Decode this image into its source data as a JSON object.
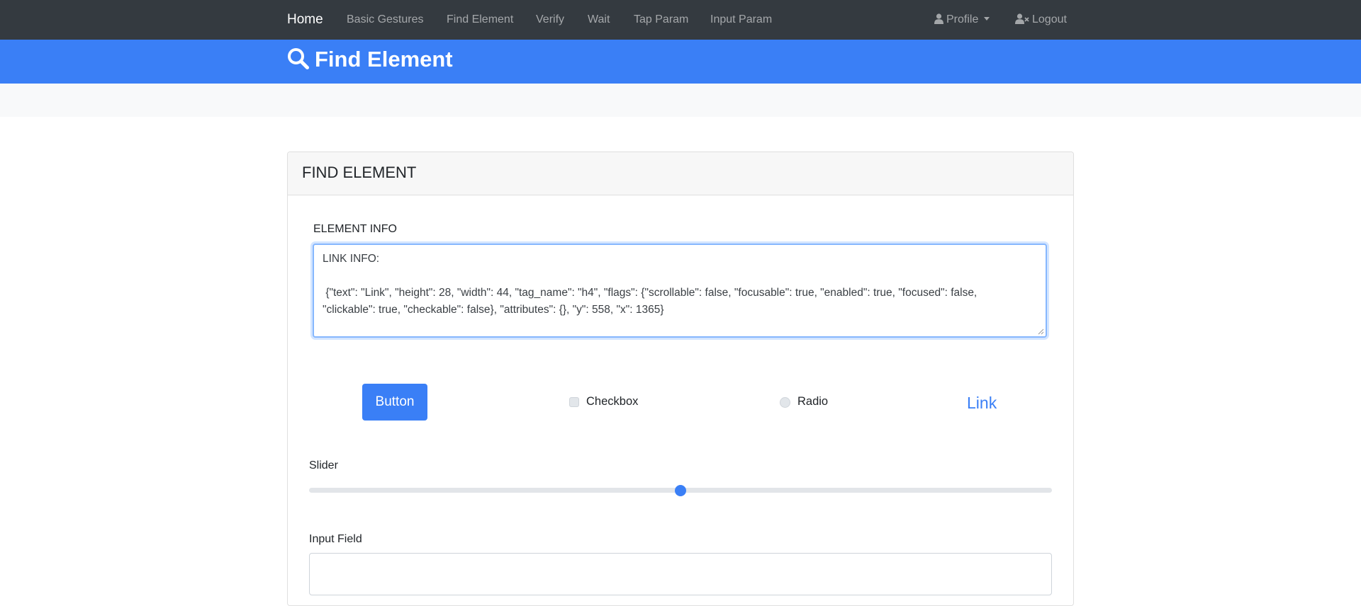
{
  "navbar": {
    "brand": "Home",
    "links": [
      "Basic Gestures",
      "Find Element",
      "Verify",
      "Wait",
      "Tap Param",
      "Input Param"
    ],
    "profile": "Profile",
    "logout": "Logout"
  },
  "hero": {
    "title": "Find Element"
  },
  "card": {
    "title": "FIND ELEMENT",
    "element_info_label": "ELEMENT INFO",
    "element_info_lines": [
      "LINK INFO:",
      "",
      " {\"text\": \"Link\", \"height\": 28, \"width\": 44, \"tag_name\": \"h4\", \"flags\": {\"scrollable\": false, \"focusable\": true, \"enabled\": true, \"focused\": false,",
      "\"clickable\": true, \"checkable\": false}, \"attributes\": {}, \"y\": 558, \"x\": 1365}"
    ],
    "button_label": "Button",
    "checkbox_label": "Checkbox",
    "checkbox_checked": false,
    "radio_label": "Radio",
    "radio_selected": false,
    "link_label": "Link",
    "slider_label": "Slider",
    "slider_value_percent": 50,
    "input_label": "Input Field",
    "input_value": ""
  },
  "colors": {
    "navbar_bg": "#343a40",
    "primary": "#3a7ff6",
    "subbar_bg": "#f8f9fa"
  }
}
